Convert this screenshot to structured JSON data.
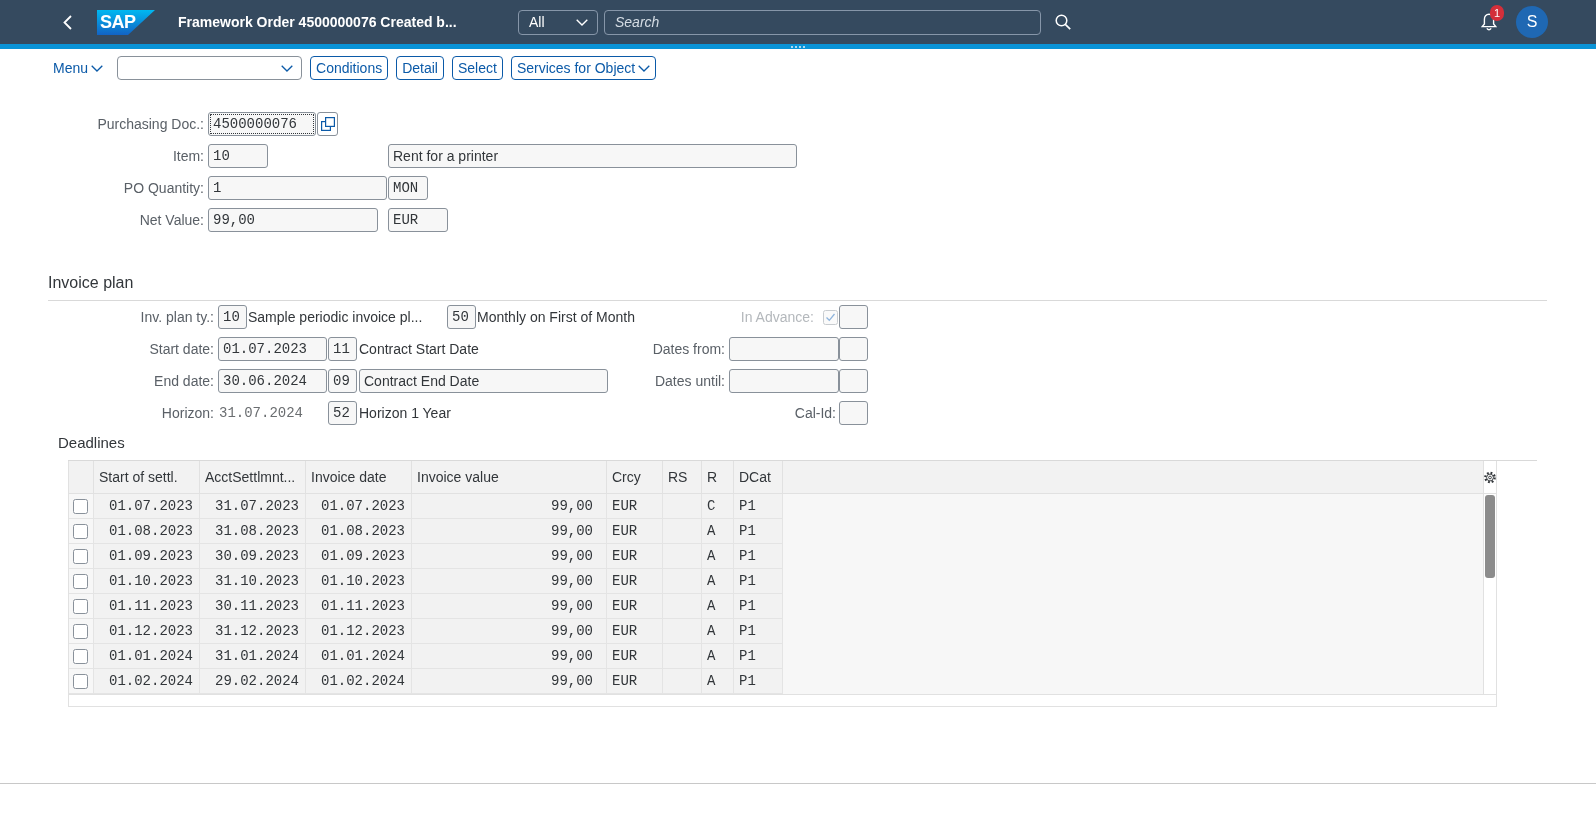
{
  "shell_bar": {
    "logo_text": "SAP",
    "title": "Framework Order 4500000076 Created b...",
    "search_scope": "All",
    "search": {
      "placeholder": "Search"
    },
    "notification_count": "1",
    "avatar_initial": "S"
  },
  "toolbar": {
    "menu": "Menu",
    "buttons": [
      {
        "label": "Conditions",
        "kind": "plain"
      },
      {
        "label": "Detail",
        "kind": "plain"
      },
      {
        "label": "Select",
        "kind": "plain"
      },
      {
        "label": "Services for Object",
        "kind": "menu"
      }
    ]
  },
  "document": {
    "purchasing_doc": {
      "label": "Purchasing Doc.:",
      "value": "4500000076",
      "focused": true
    },
    "item": {
      "label": "Item:",
      "value": "10",
      "description": "Rent for a printer"
    },
    "po_quantity": {
      "label": "PO Quantity:",
      "value": "1",
      "unit": "MON"
    },
    "net_value": {
      "label": "Net Value:",
      "value": "99,00",
      "currency": "EUR"
    }
  },
  "invoice_plan": {
    "title": "Invoice plan",
    "plan_type": {
      "label": "Inv. plan ty.:",
      "code": "10",
      "text": "Sample periodic invoice pl..."
    },
    "date_rule": {
      "code": "50",
      "text": "Monthly on First of Month"
    },
    "in_advance": {
      "label": "In Advance:",
      "checked": true,
      "disabled": true
    },
    "date_rows": [
      {
        "label": "Start date:",
        "date": {
          "value": "01.07.2023",
          "kind": "field"
        },
        "rule": {
          "code": "11",
          "text": "Contract Start Date",
          "kind": "text"
        },
        "right": {
          "label": "Dates from:",
          "kind": "date_range"
        }
      },
      {
        "label": "End date:",
        "date": {
          "value": "30.06.2024",
          "kind": "field"
        },
        "rule": {
          "code": "09",
          "text": "Contract End Date",
          "kind": "field"
        },
        "right": {
          "label": "Dates until:",
          "kind": "date_range"
        }
      },
      {
        "label": "Horizon:",
        "date": {
          "value": "31.07.2024",
          "kind": "text"
        },
        "rule": {
          "code": "52",
          "text": "Horizon 1 Year",
          "kind": "text"
        },
        "right": {
          "label": "Cal-Id:",
          "kind": "code"
        }
      }
    ]
  },
  "deadlines": {
    "title": "Deadlines",
    "columns": [
      "Start of settl.",
      "AcctSettlmnt...",
      "Invoice date",
      "Invoice value",
      "Crcy",
      "RS",
      "R",
      "DCat"
    ],
    "rows": [
      {
        "checked": false,
        "start_of_settl": "01.07.2023",
        "acct_settlmnt": "31.07.2023",
        "invoice_date": "01.07.2023",
        "invoice_value": "99,00",
        "crcy": "EUR",
        "r": "C",
        "dcat": "P1"
      },
      {
        "checked": false,
        "start_of_settl": "01.08.2023",
        "acct_settlmnt": "31.08.2023",
        "invoice_date": "01.08.2023",
        "invoice_value": "99,00",
        "crcy": "EUR",
        "r": "A",
        "dcat": "P1"
      },
      {
        "checked": false,
        "start_of_settl": "01.09.2023",
        "acct_settlmnt": "30.09.2023",
        "invoice_date": "01.09.2023",
        "invoice_value": "99,00",
        "crcy": "EUR",
        "r": "A",
        "dcat": "P1"
      },
      {
        "checked": false,
        "start_of_settl": "01.10.2023",
        "acct_settlmnt": "31.10.2023",
        "invoice_date": "01.10.2023",
        "invoice_value": "99,00",
        "crcy": "EUR",
        "r": "A",
        "dcat": "P1"
      },
      {
        "checked": false,
        "start_of_settl": "01.11.2023",
        "acct_settlmnt": "30.11.2023",
        "invoice_date": "01.11.2023",
        "invoice_value": "99,00",
        "crcy": "EUR",
        "r": "A",
        "dcat": "P1"
      },
      {
        "checked": false,
        "start_of_settl": "01.12.2023",
        "acct_settlmnt": "31.12.2023",
        "invoice_date": "01.12.2023",
        "invoice_value": "99,00",
        "crcy": "EUR",
        "r": "A",
        "dcat": "P1"
      },
      {
        "checked": false,
        "start_of_settl": "01.01.2024",
        "acct_settlmnt": "31.01.2024",
        "invoice_date": "01.01.2024",
        "invoice_value": "99,00",
        "crcy": "EUR",
        "r": "A",
        "dcat": "P1"
      },
      {
        "checked": false,
        "start_of_settl": "01.02.2024",
        "acct_settlmnt": "29.02.2024",
        "invoice_date": "01.02.2024",
        "invoice_value": "99,00",
        "crcy": "EUR",
        "r": "A",
        "dcat": "P1"
      }
    ]
  }
}
